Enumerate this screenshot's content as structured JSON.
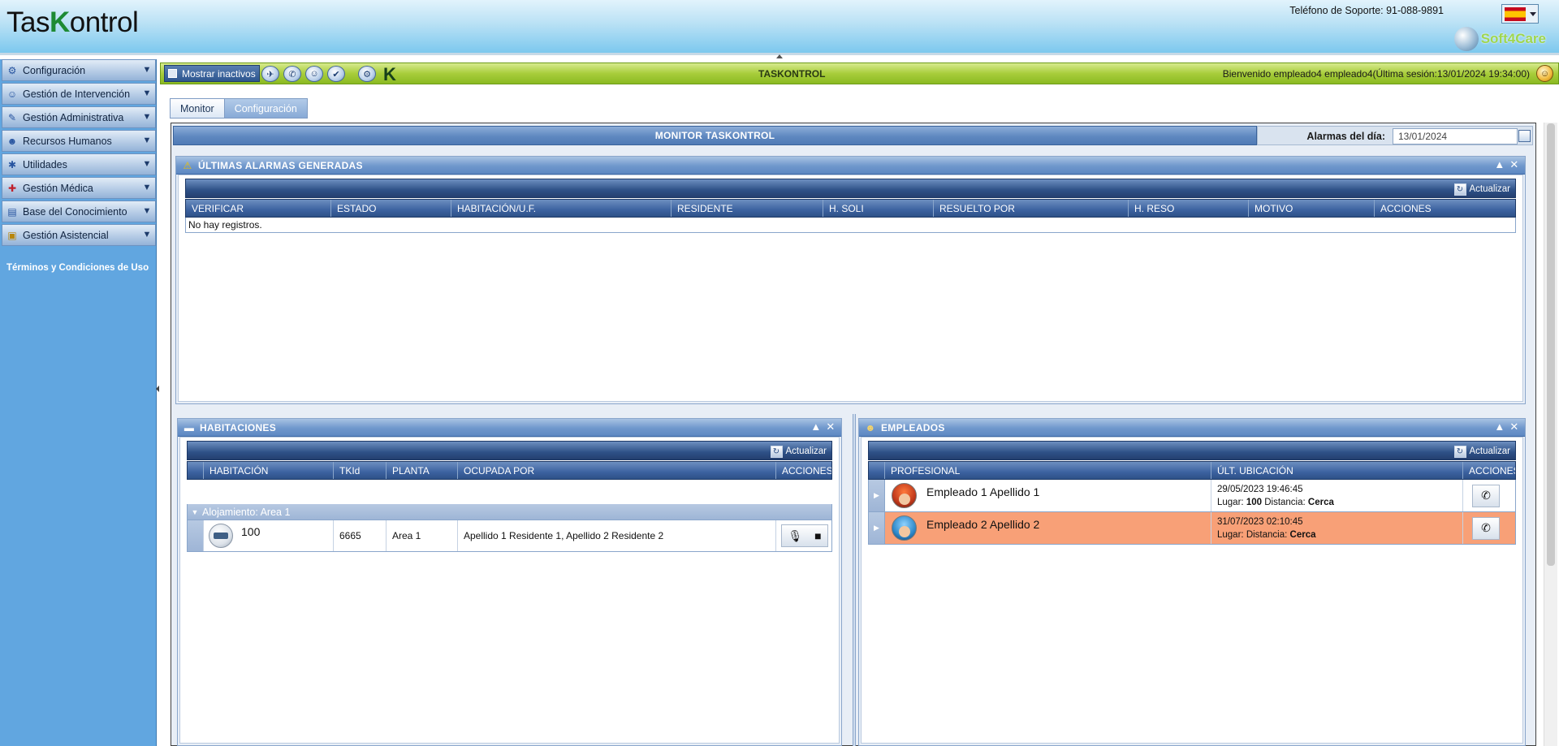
{
  "header": {
    "logo_pre": "Tas",
    "logo_k": "K",
    "logo_post": "ontrol",
    "support": "Teléfono de Soporte: 91-088-9891",
    "brand": "Soft4Care"
  },
  "sidebar": {
    "items": [
      {
        "label": "Configuración",
        "icon": "gear-icon"
      },
      {
        "label": "Gestión de Intervención",
        "icon": "people-icon"
      },
      {
        "label": "Gestión Administrativa",
        "icon": "pen-icon"
      },
      {
        "label": "Recursos Humanos",
        "icon": "team-icon"
      },
      {
        "label": "Utilidades",
        "icon": "tools-icon"
      },
      {
        "label": "Gestión Médica",
        "icon": "medical-cross-icon"
      },
      {
        "label": "Base del Conocimiento",
        "icon": "book-icon"
      },
      {
        "label": "Gestión Asistencial",
        "icon": "clipboard-icon"
      }
    ],
    "terms": "Términos y Condiciones de Uso"
  },
  "toolbar": {
    "inactive_label": "Mostrar inactivos",
    "title": "TASKONTROL",
    "welcome": "Bienvenido  empleado4 empleado4(Última sesión:13/01/2024 19:34:00)"
  },
  "tabs": [
    {
      "label": "Monitor"
    },
    {
      "label": "Configuración"
    }
  ],
  "monitor": {
    "title": "MONITOR TASKONTROL",
    "alarm_date_label": "Alarmas del día:",
    "alarm_date_value": "13/01/2024"
  },
  "alarms": {
    "title": "ÚLTIMAS ALARMAS GENERADAS",
    "refresh": "Actualizar",
    "columns": [
      "VERIFICAR",
      "ESTADO",
      "HABITACIÓN/U.F.",
      "RESIDENTE",
      "H. SOLI",
      "RESUELTO POR",
      "H. RESO",
      "MOTIVO",
      "ACCIONES"
    ],
    "empty": "No hay registros."
  },
  "rooms": {
    "title": "HABITACIONES",
    "refresh": "Actualizar",
    "columns": [
      "HABITACIÓN",
      "TKId",
      "PLANTA",
      "OCUPADA POR",
      "ACCIONES"
    ],
    "group": "Alojamiento: Area 1",
    "rows": [
      {
        "room": "100",
        "tkid": "6665",
        "floor": "Area 1",
        "occupied": "Apellido 1 Residente 1, Apellido 2 Residente 2"
      }
    ]
  },
  "employees": {
    "title": "EMPLEADOS",
    "refresh": "Actualizar",
    "columns": [
      "PROFESIONAL",
      "ÚLT. UBICACIÓN",
      "ACCIONES"
    ],
    "rows": [
      {
        "name": "Empleado 1 Apellido 1",
        "datetime": "29/05/2023 19:46:45",
        "lugar_label": "Lugar:",
        "lugar_value": "100",
        "dist_label": "Distancia:",
        "dist_value": "Cerca",
        "highlight_color": "#ffffff"
      },
      {
        "name": "Empleado 2 Apellido 2",
        "datetime": "31/07/2023 02:10:45",
        "lugar_label": "Lugar:",
        "lugar_value": "",
        "dist_label": "Distancia:",
        "dist_value": "Cerca",
        "highlight_color": "#f8a077"
      }
    ]
  },
  "colors": {
    "sidebar_bg": "#61a6e0",
    "toolbar_green": "#a8cd3b",
    "panel_blue": "#3c62a0",
    "highlight_row": "#f8a077"
  }
}
